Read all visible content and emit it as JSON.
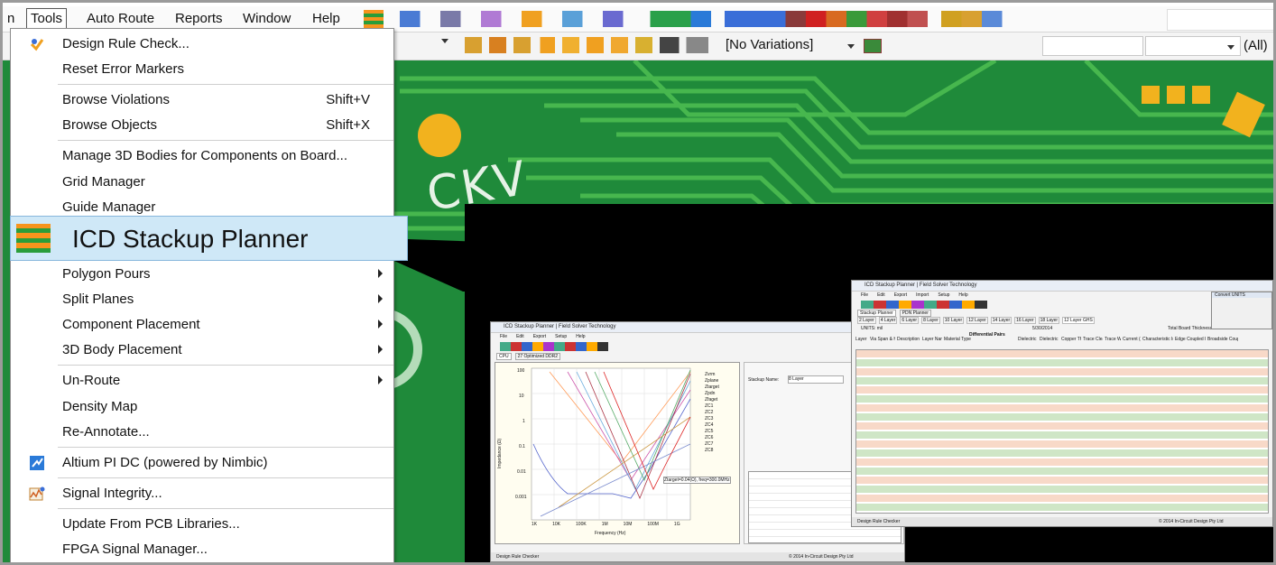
{
  "menubar": {
    "items": [
      {
        "label": "n"
      },
      {
        "label": "Tools"
      },
      {
        "label": "Auto Route"
      },
      {
        "label": "Reports"
      },
      {
        "label": "Window"
      },
      {
        "label": "Help"
      }
    ]
  },
  "toolbar": {
    "variations": "[No Variations]",
    "filter": "(All)"
  },
  "pcb_label": "CKV",
  "tools_menu": {
    "items": [
      {
        "label": "Design Rule Check...",
        "shortcut": "",
        "submenu": false
      },
      {
        "label": "Reset Error Markers",
        "shortcut": "",
        "submenu": false
      },
      {
        "label": "Browse Violations",
        "shortcut": "Shift+V",
        "submenu": false
      },
      {
        "label": "Browse Objects",
        "shortcut": "Shift+X",
        "submenu": false
      },
      {
        "label": "Manage 3D Bodies for Components on Board...",
        "shortcut": "",
        "submenu": false
      },
      {
        "label": "Grid Manager",
        "shortcut": "",
        "submenu": false
      },
      {
        "label": "Guide Manager",
        "shortcut": "",
        "submenu": false
      },
      {
        "label": "ICD Stackup Planner",
        "shortcut": "",
        "submenu": false
      },
      {
        "label": "Polygon Pours",
        "shortcut": "",
        "submenu": true
      },
      {
        "label": "Split Planes",
        "shortcut": "",
        "submenu": true
      },
      {
        "label": "Component Placement",
        "shortcut": "",
        "submenu": true
      },
      {
        "label": "3D Body Placement",
        "shortcut": "",
        "submenu": true
      },
      {
        "label": "Un-Route",
        "shortcut": "",
        "submenu": true
      },
      {
        "label": "Density Map",
        "shortcut": "",
        "submenu": false
      },
      {
        "label": "Re-Annotate...",
        "shortcut": "",
        "submenu": false
      },
      {
        "label": "Altium PI DC (powered by Nimbic)",
        "shortcut": "",
        "submenu": false
      },
      {
        "label": "Signal Integrity...",
        "shortcut": "",
        "submenu": false
      },
      {
        "label": "Update From PCB Libraries...",
        "shortcut": "",
        "submenu": false
      },
      {
        "label": "FPGA Signal Manager...",
        "shortcut": "",
        "submenu": false
      }
    ]
  },
  "window_left": {
    "title": "ICD Stackup Planner | Field Solver Technology",
    "menus": [
      "File",
      "Edit",
      "Export",
      "Setup",
      "Help"
    ],
    "tabs": [
      "CPU",
      "27 Optimized DDR2"
    ],
    "chart_ylabel": "Impedance (Ω)",
    "chart_xlabel": "Frequency (Hz)",
    "y_ticks": [
      "100",
      "10",
      "1",
      "0.1",
      "0.01",
      "0.001"
    ],
    "x_ticks": [
      "1K",
      "10K",
      "100K",
      "1M",
      "10M",
      "100M",
      "1G"
    ],
    "legend": [
      "Zvrm",
      "Zplane",
      "Ztarget",
      "Zpdn",
      "Zfaget",
      "ZC1",
      "ZC2",
      "ZC3",
      "ZC4",
      "ZC5",
      "ZC6",
      "ZC7",
      "ZC8"
    ],
    "cursor_label": "Ztarget=0.04(Ω), freq=300.0MHz",
    "status": "Design Rule Checker",
    "copyright": "© 2014 In-Circuit Design Pty Ltd",
    "stackup_name_label": "Stackup Name:",
    "stackup_name_value": "8 Layer"
  },
  "window_right": {
    "title": "ICD Stackup Planner | Field Solver Technology",
    "menus": [
      "File",
      "Edit",
      "Export",
      "Import",
      "Setup",
      "Help"
    ],
    "tabs": [
      "Stackup Planner",
      "PDN Planner"
    ],
    "layer_tabs": [
      "2 Layer",
      "4 Layer",
      "6 Layer",
      "8 Layer",
      "10 Layer",
      "12 Layer",
      "14 Layer",
      "16 Layer",
      "18 Layer",
      "12 Layer GHS"
    ],
    "units": "UNITS: mil",
    "date": "5/30/2014",
    "board_thickness": "Total Board Thickness: 124.8 mil",
    "diff_pairs": "Differential Pairs",
    "headers": [
      "Layer No.",
      "Via Span & Hole Diameter",
      "Description",
      "Layer Name",
      "Material Type",
      "Dielectric Constant",
      "Dielectric Thickness",
      "Copper Thickness",
      "Trace Clearance",
      "Trace Width",
      "Current (Amps)",
      "Characteristic Impedance (Zo)",
      "Edge Coupled Differential (Zdiff)",
      "Broadside Coupled Differential (Zdbs)"
    ],
    "status": "Design Rule Checker",
    "copyright": "© 2014 In-Circuit Design Pty Ltd",
    "dialog_title": "Convert UNITS"
  }
}
